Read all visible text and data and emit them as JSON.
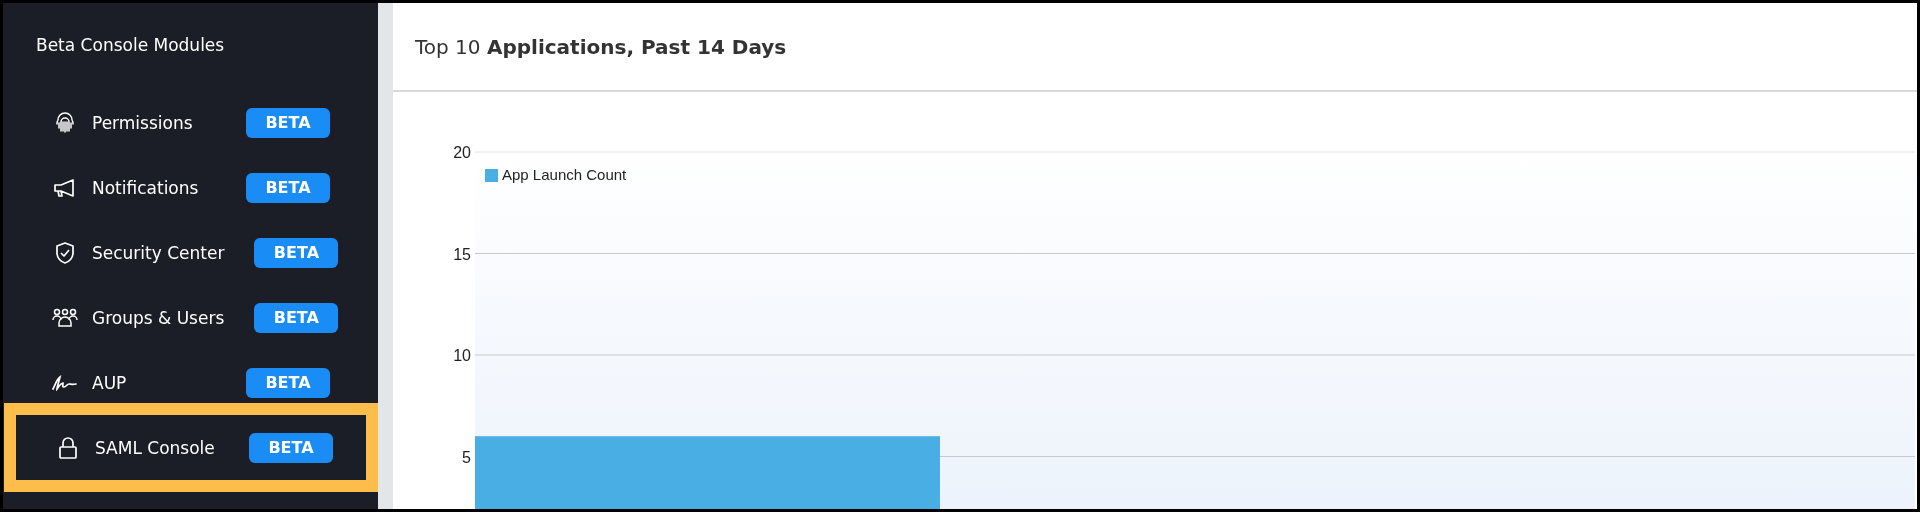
{
  "sidebar": {
    "title": "Beta Console Modules",
    "items": [
      {
        "label": "Permissions",
        "badge": "BETA",
        "selected": false
      },
      {
        "label": "Notifications",
        "badge": "BETA",
        "selected": false
      },
      {
        "label": "Security Center",
        "badge": "BETA",
        "selected": false
      },
      {
        "label": "Groups & Users",
        "badge": "BETA",
        "selected": false
      },
      {
        "label": "AUP",
        "badge": "BETA",
        "selected": false
      },
      {
        "label": "SAML Console",
        "badge": "BETA",
        "selected": true
      }
    ]
  },
  "panel": {
    "title": "Top 10 **Applications, Past 14 Days**",
    "chart_data": {
      "type": "bar",
      "grid": true,
      "ylim": [
        0,
        20
      ],
      "yticks": [
        5,
        10,
        15,
        20
      ],
      "series": [
        {
          "name": "App Launch Count",
          "color": "#49aee3",
          "values": [
            6
          ]
        }
      ]
    }
  }
}
